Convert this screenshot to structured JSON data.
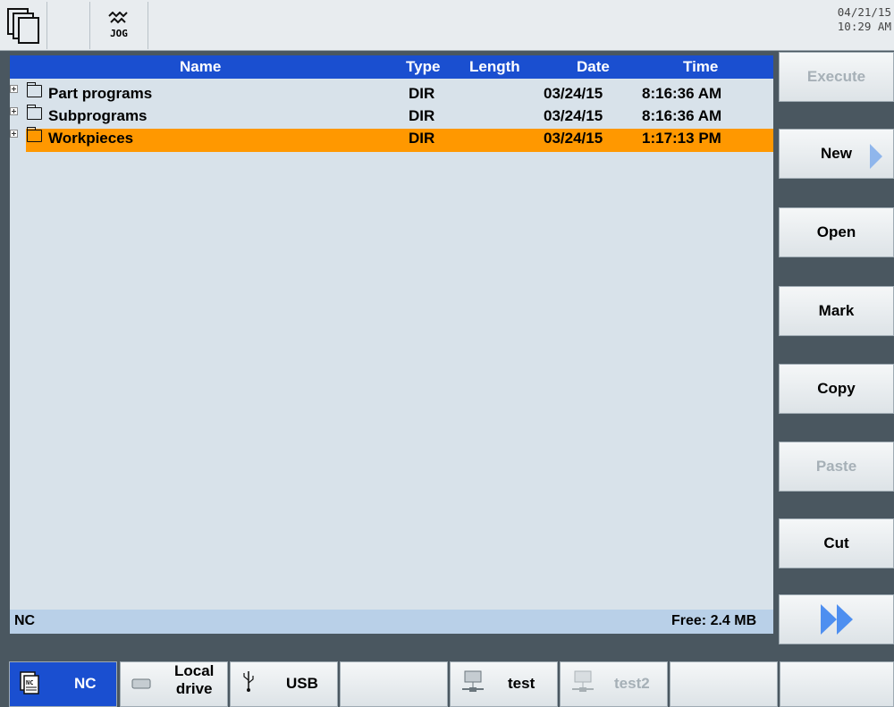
{
  "header": {
    "mode_label": "JOG",
    "date": "04/21/15",
    "time": "10:29 AM"
  },
  "file_list": {
    "columns": [
      "Name",
      "Type",
      "Length",
      "Date",
      "Time"
    ],
    "rows": [
      {
        "name": "Part programs",
        "type": "DIR",
        "length": "",
        "date": "03/24/15",
        "time": "8:16:36 AM",
        "selected": false
      },
      {
        "name": "Subprograms",
        "type": "DIR",
        "length": "",
        "date": "03/24/15",
        "time": "8:16:36 AM",
        "selected": false
      },
      {
        "name": "Workpieces",
        "type": "DIR",
        "length": "",
        "date": "03/24/15",
        "time": "1:17:13 PM",
        "selected": true
      }
    ]
  },
  "status_bar": {
    "location": "NC",
    "free": "Free: 2.4 MB"
  },
  "vertical_softkeys": [
    {
      "label": "Execute",
      "enabled": false
    },
    {
      "label": "New",
      "enabled": true,
      "has_submenu": true
    },
    {
      "label": "Open",
      "enabled": true
    },
    {
      "label": "Mark",
      "enabled": true
    },
    {
      "label": "Copy",
      "enabled": true
    },
    {
      "label": "Paste",
      "enabled": false
    },
    {
      "label": "Cut",
      "enabled": true
    },
    {
      "label": "",
      "icon": "double-arrow-right-icon",
      "enabled": true
    }
  ],
  "horizontal_softkeys": [
    {
      "label": "NC",
      "icon": "nc-drive-icon",
      "active": true
    },
    {
      "label_line1": "Local",
      "label_line2": "drive",
      "icon": "local-drive-icon"
    },
    {
      "label": "USB",
      "icon": "usb-icon"
    },
    {
      "label": ""
    },
    {
      "label": "test",
      "icon": "network-drive-icon"
    },
    {
      "label": "test2",
      "icon": "network-drive-icon",
      "enabled": false
    },
    {
      "label": ""
    },
    {
      "label": ""
    }
  ],
  "colors": {
    "header_blue": "#1a4fd0",
    "selection_orange": "#ff9800",
    "panel_bg": "#d8e2ea",
    "arrow_blue": "#4e8ff0"
  }
}
